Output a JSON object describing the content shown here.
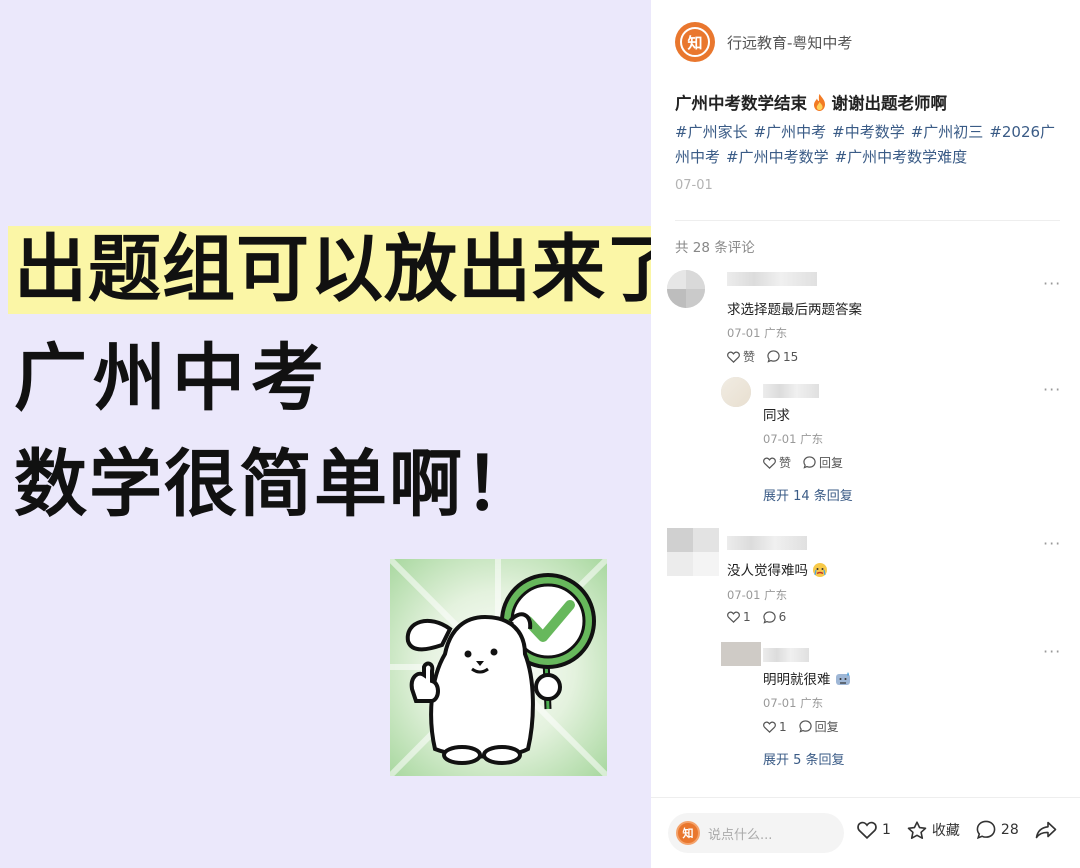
{
  "image": {
    "headline": "出题组可以放出来了",
    "line2": "广州中考",
    "line3": "数学很简单啊！"
  },
  "post": {
    "author_name": "行远教育-粤知中考",
    "avatar_char": "知",
    "title": "广州中考数学结束",
    "title_suffix": "谢谢出题老师啊",
    "tags": [
      "#广州家长",
      "#广州中考",
      "#中考数学",
      "#广州初三",
      "#2026广州中考",
      "#广州中考数学",
      "#广州中考数学难度"
    ],
    "date": "07-01",
    "comment_count_label": "共 28 条评论"
  },
  "comments": [
    {
      "text": "求选择题最后两题答案",
      "meta": "07-01 广东",
      "like_label": "赞",
      "reply_count": "15",
      "replies": [
        {
          "text": "同求",
          "meta": "07-01 广东",
          "like_label": "赞",
          "reply_label": "回复"
        }
      ],
      "expand_label": "展开 14 条回复"
    },
    {
      "text": "没人觉得难吗",
      "meta": "07-01 广东",
      "like_count": "1",
      "reply_count": "6",
      "replies": [
        {
          "text": "明明就很难",
          "meta": "07-01 广东",
          "like_count": "1",
          "reply_label": "回复"
        }
      ],
      "expand_label": "展开 5 条回复"
    }
  ],
  "bottom_bar": {
    "input_placeholder": "说点什么...",
    "like_count": "1",
    "favorite_label": "收藏",
    "comment_count": "28"
  },
  "colors": {
    "brand_orange": "#e9772e",
    "tag_blue": "#3a5b86",
    "image_bg": "#ebe8fb",
    "highlight_yellow": "#fbf6a6",
    "sticker_green": "#4caf50"
  },
  "icons": [
    "flame-icon",
    "heart-icon",
    "comment-icon",
    "star-icon",
    "share-icon",
    "more-icon",
    "check-sign-icon",
    "dog-sticker"
  ]
}
